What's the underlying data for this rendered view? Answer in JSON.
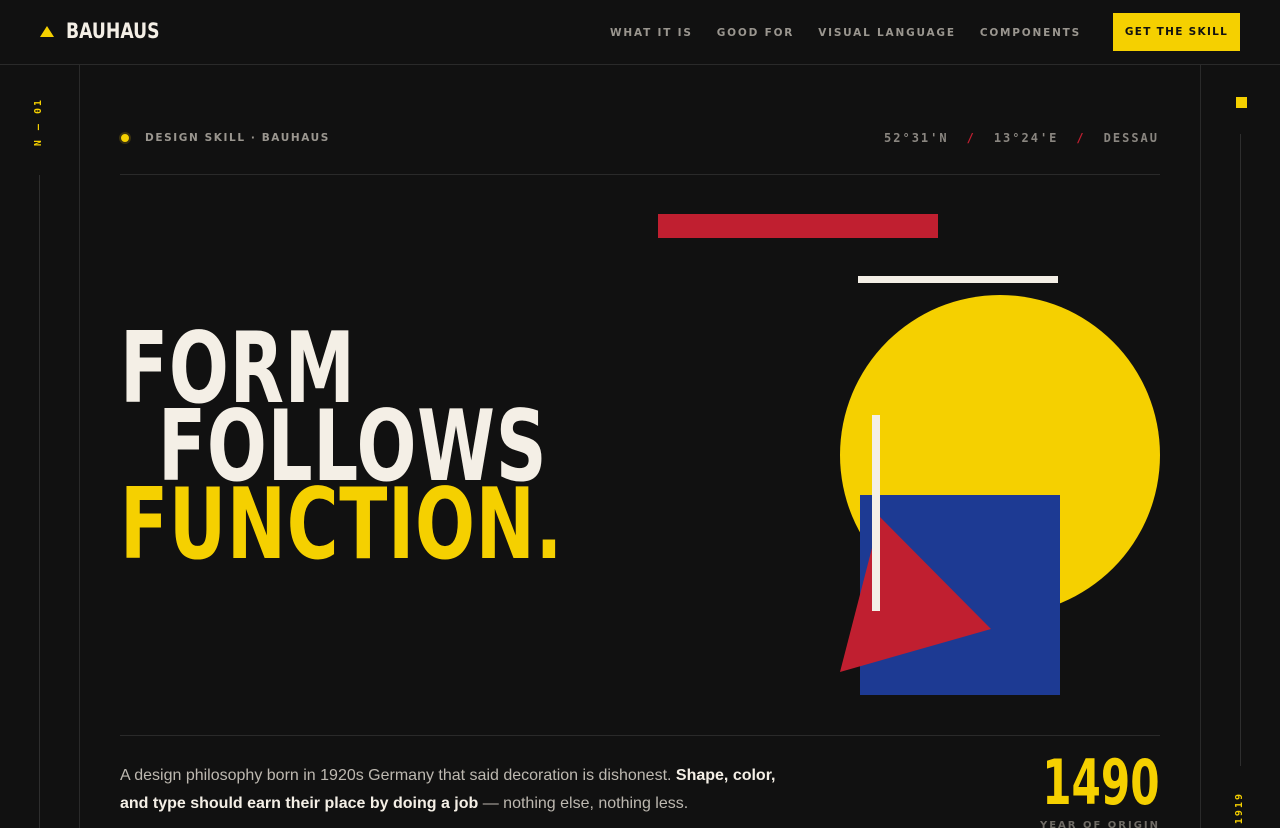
{
  "header": {
    "logo_text": "BAUHAUS",
    "nav": [
      "WHAT IT IS",
      "GOOD FOR",
      "VISUAL LANGUAGE",
      "COMPONENTS"
    ],
    "cta_label": "GET THE SKILL"
  },
  "rails": {
    "left_label": "N — 01",
    "right_label": "1919"
  },
  "meta": {
    "tag": "DESIGN SKILL · BAUHAUS",
    "lat": "52°31'N",
    "lon": "13°24'E",
    "place": "DESSAU",
    "separator": "/"
  },
  "hero": {
    "line1": "FORM",
    "line2": "FOLLOWS",
    "line3": "FUNCTION."
  },
  "description": {
    "intro": "A design philosophy born in 1920s Germany that said decoration is dishonest. ",
    "emphasis": "Shape, color, and type should earn their place by doing a job",
    "outro": " — nothing else, nothing less."
  },
  "stat": {
    "value": "1490",
    "label": "YEAR OF ORIGIN"
  },
  "colors": {
    "background": "#111111",
    "yellow": "#f5d000",
    "red": "#c01f30",
    "blue": "#1d3a93",
    "cream": "#f4efe6"
  },
  "icons": {
    "logo": "triangle-icon",
    "meta": "dot-icon",
    "rail": "square-icon"
  }
}
